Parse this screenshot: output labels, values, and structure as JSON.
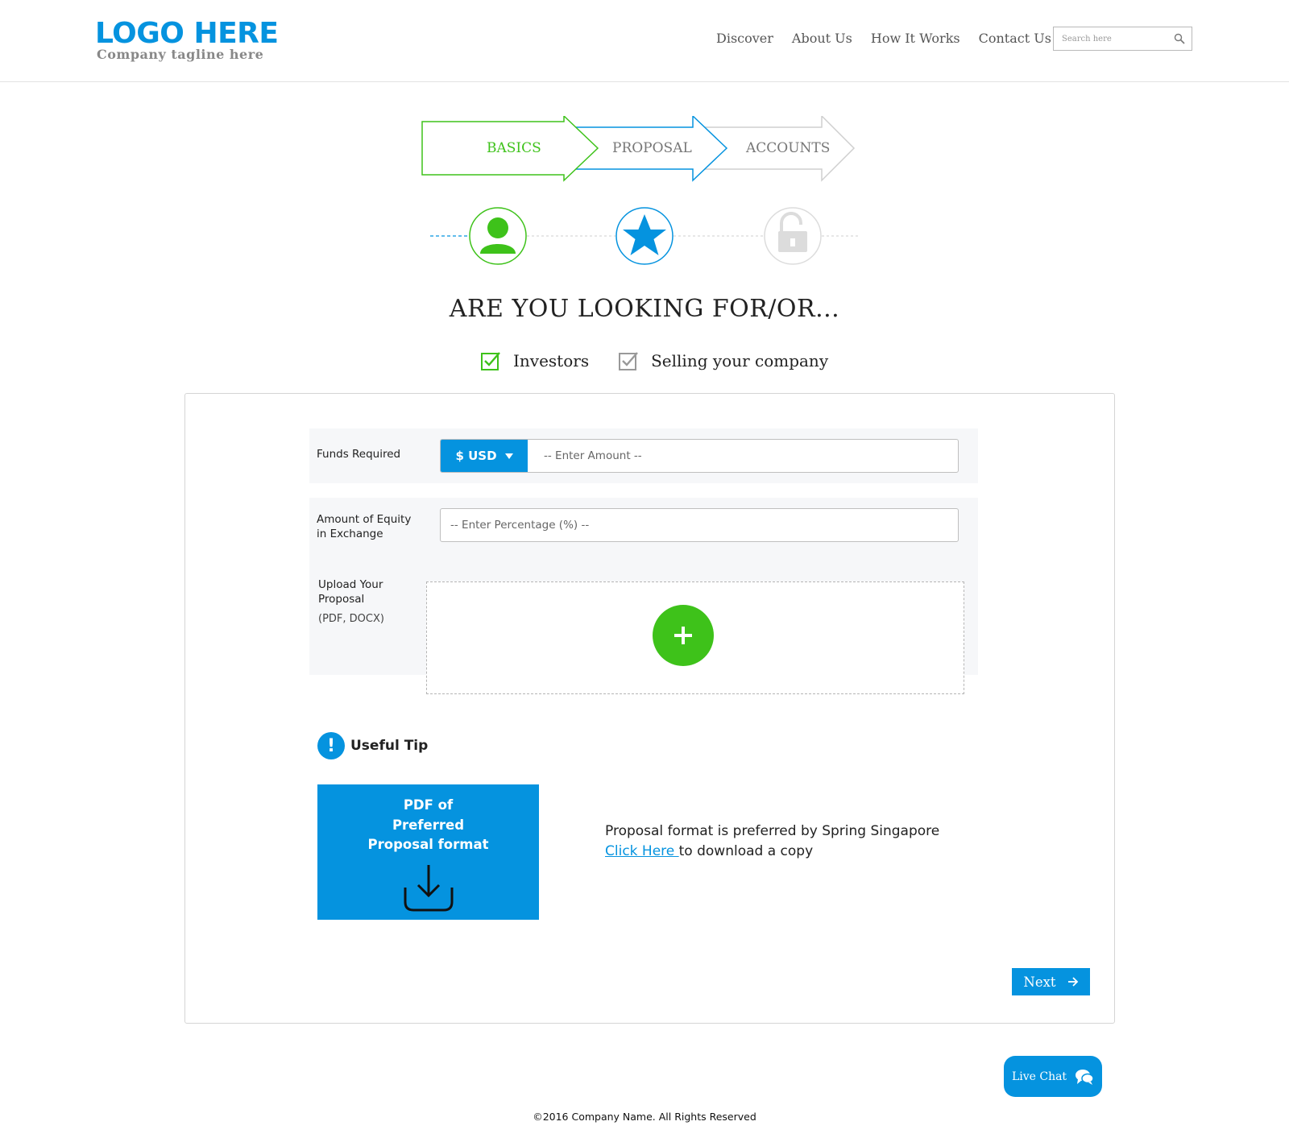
{
  "header": {
    "logo_title": "LOGO HERE",
    "logo_tagline": "Company tagline here",
    "nav": [
      "Discover",
      "About Us",
      "How It Works",
      "Contact Us"
    ],
    "search_placeholder": "Search here",
    "search_icon": "search-icon"
  },
  "steps": [
    {
      "label": "BASICS",
      "color": "#3ec21a",
      "icon": "user-icon"
    },
    {
      "label": "PROPOSAL",
      "color": "#0593df",
      "icon": "star-icon"
    },
    {
      "label": "ACCOUNTS",
      "color": "#999999",
      "icon": "lock-icon"
    }
  ],
  "question": "ARE YOU LOOKING FOR/OR...",
  "options": [
    {
      "label": "Investors",
      "checked": true,
      "color": "#3ec21a"
    },
    {
      "label": "Selling your company",
      "checked": true,
      "color": "#999999"
    }
  ],
  "form": {
    "funds_label": "Funds Required",
    "currency": "$ USD",
    "amount_placeholder": "-- Enter Amount --",
    "equity_label_line1": "Amount of Equity",
    "equity_label_line2": "in Exchange",
    "equity_placeholder": "-- Enter Percentage (%) --",
    "upload_label_line1": "Upload Your",
    "upload_label_line2": "Proposal",
    "upload_formats": "(PDF, DOCX)"
  },
  "tip": {
    "title": "Useful Tip",
    "card_line1": "PDF of",
    "card_line2": "Preferred",
    "card_line3": "Proposal format",
    "text": "Proposal format is preferred by Spring Singapore",
    "link": "Click Here ",
    "link_suffix": "to download a copy"
  },
  "next_label": "Next",
  "live_chat_label": "Live Chat",
  "footer": "©2016 Company Name. All Rights Reserved",
  "colors": {
    "accent": "#0593df",
    "green": "#3ec21a",
    "gray": "#999999"
  }
}
